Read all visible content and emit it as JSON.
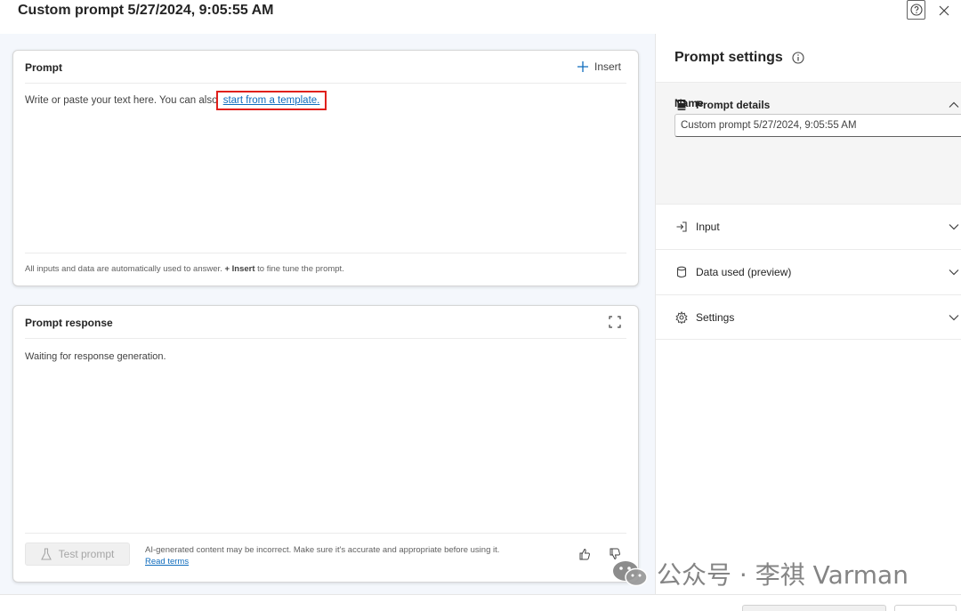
{
  "window": {
    "title": "Custom prompt 5/27/2024, 9:05:55 AM",
    "help_icon": "question-circle-icon",
    "close_icon": "close-icon"
  },
  "prompt": {
    "title": "Prompt",
    "insert_label": "Insert",
    "body_text": "Write or paste your text here. You can also ",
    "template_link": "start from a template",
    "body_period": ".",
    "footer_text": "All inputs and data are automatically used to answer. ",
    "footer_insert": "+ Insert",
    "footer_tail": " to fine tune the prompt."
  },
  "response": {
    "title": "Prompt response",
    "waiting_text": "Waiting for response generation.",
    "test_button": "Test prompt",
    "disclaimer": "AI-generated content may be incorrect. Make sure it's accurate and appropriate before using it.",
    "read_terms": "Read terms"
  },
  "settings": {
    "title": "Prompt settings",
    "details_label": "Prompt details",
    "name_label": "Name",
    "name_value": "Custom prompt 5/27/2024, 9:05:55 AM",
    "input_label": "Input",
    "data_label": "Data used (preview)",
    "settings_label": "Settings"
  },
  "watermark": {
    "text": "公众号 · 李祺 Varman"
  },
  "colors": {
    "link": "#0f6cbd",
    "highlight": "#e0201c",
    "left_bg": "#f4f7fc"
  }
}
